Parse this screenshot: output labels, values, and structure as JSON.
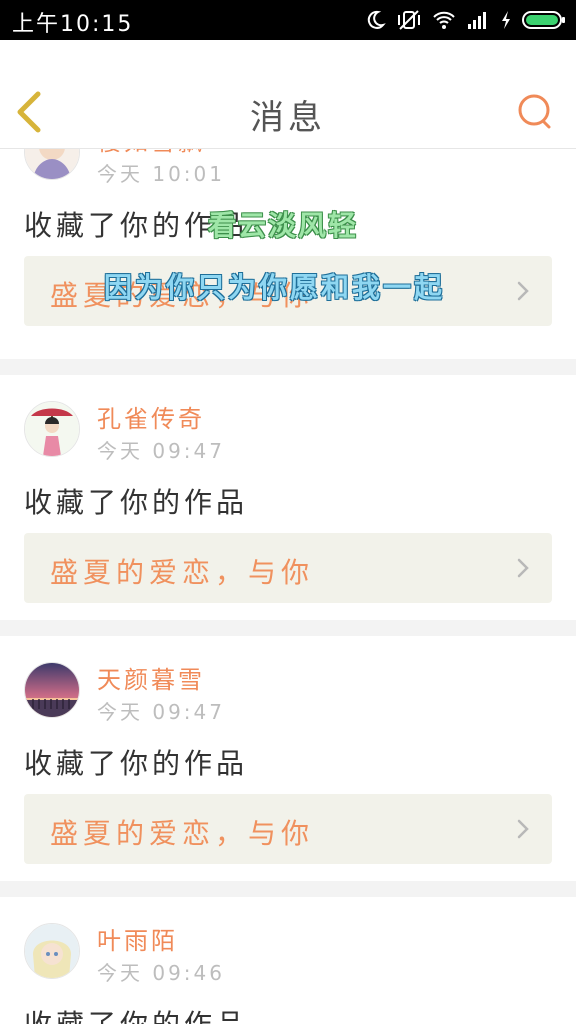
{
  "status_bar": {
    "time": "上午10:15",
    "icons": [
      "moon-icon",
      "vibrate-off-icon",
      "wifi-icon",
      "signal-icon",
      "charging-icon",
      "battery-icon"
    ]
  },
  "header": {
    "title": "消息",
    "back_icon": "chevron-left-icon",
    "search_icon": "search-icon",
    "accent": "#f08a58",
    "back_color": "#d7b43a"
  },
  "feed": {
    "items": [
      {
        "username": "樱如雪飘",
        "time": "今天 10:01",
        "action": "收藏了你的作品",
        "work_title": "盛夏的爱恋，与你"
      },
      {
        "username": "孔雀传奇",
        "time": "今天 09:47",
        "action": "收藏了你的作品",
        "work_title": "盛夏的爱恋，与你"
      },
      {
        "username": "天颜暮雪",
        "time": "今天 09:47",
        "action": "收藏了你的作品",
        "work_title": "盛夏的爱恋，与你"
      },
      {
        "username": "叶雨陌",
        "time": "今天 09:46",
        "action": "收藏了你的作品",
        "work_title": ""
      }
    ]
  },
  "overlay": {
    "line1": "看云淡风轻",
    "line2": "因为你只为你愿和我一起"
  }
}
